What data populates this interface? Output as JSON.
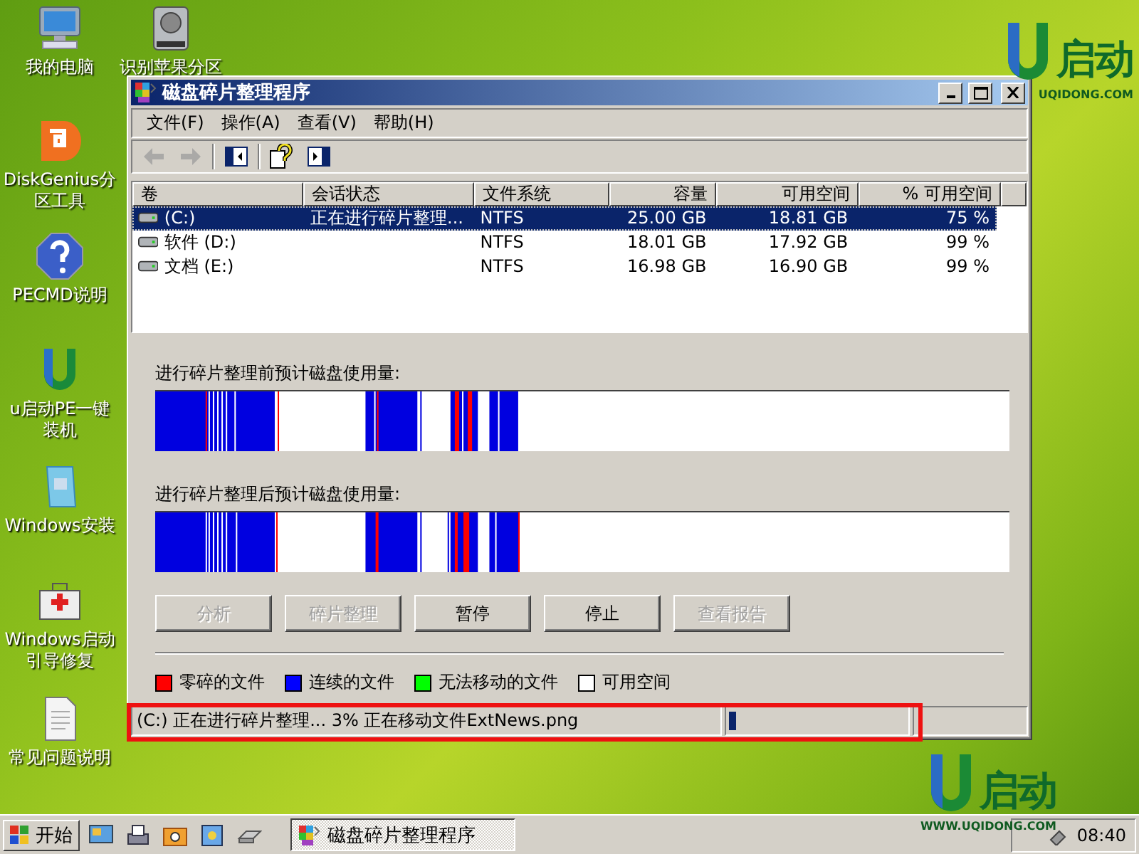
{
  "desktop_icons": [
    {
      "label": "我的电脑",
      "kind": "computer"
    },
    {
      "label": "识别苹果分区",
      "kind": "drive"
    },
    {
      "label": "DiskGenius分区工具",
      "kind": "diskgenius"
    },
    {
      "label": "PECMD说明",
      "kind": "help"
    },
    {
      "label": "u启动PE一键装机",
      "kind": "ulogo"
    },
    {
      "label": "Windows安装",
      "kind": "windows"
    },
    {
      "label": "Windows启动引导修复",
      "kind": "firstaid"
    },
    {
      "label": "常见问题说明",
      "kind": "document"
    }
  ],
  "logo_top": {
    "name": "启动",
    "site": "UQIDONG.COM"
  },
  "logo_bottom": {
    "name": "启动",
    "site": "WWW.UQIDONG.COM"
  },
  "window": {
    "title": "磁盘碎片整理程序",
    "menu": [
      "文件(F)",
      "操作(A)",
      "查看(V)",
      "帮助(H)"
    ],
    "toolbar": [
      {
        "kind": "back",
        "disabled": true
      },
      {
        "kind": "forward",
        "disabled": true
      },
      {
        "kind": "panel-left"
      },
      {
        "kind": "help"
      },
      {
        "kind": "panel-right"
      }
    ],
    "table": {
      "columns": [
        "卷",
        "会话状态",
        "文件系统",
        "容量",
        "可用空间",
        "% 可用空间"
      ],
      "rows": [
        {
          "cells": [
            "(C:)",
            "正在进行碎片整理...",
            "NTFS",
            "25.00 GB",
            "18.81 GB",
            "75 %"
          ],
          "selected": true
        },
        {
          "cells": [
            "软件 (D:)",
            "",
            "NTFS",
            "18.01 GB",
            "17.92 GB",
            "99 %"
          ],
          "selected": false
        },
        {
          "cells": [
            "文档 (E:)",
            "",
            "NTFS",
            "16.98 GB",
            "16.90 GB",
            "99 %"
          ],
          "selected": false
        }
      ]
    },
    "before_label": "进行碎片整理前预计磁盘使用量:",
    "after_label": "进行碎片整理后预计磁盘使用量:",
    "buttons": [
      {
        "label": "分析",
        "disabled": true
      },
      {
        "label": "碎片整理",
        "disabled": true
      },
      {
        "label": "暂停",
        "disabled": false
      },
      {
        "label": "停止",
        "disabled": false
      },
      {
        "label": "查看报告",
        "disabled": true
      }
    ],
    "legend": [
      {
        "label": "零碎的文件",
        "color": "#ff0000"
      },
      {
        "label": "连续的文件",
        "color": "#0000ff"
      },
      {
        "label": "无法移动的文件",
        "color": "#00ff00"
      },
      {
        "label": "可用空间",
        "color": "#ffffff"
      }
    ],
    "status_bar": {
      "text": "(C:) 正在进行碎片整理... 3%  正在移动文件ExtNews.png",
      "level": 0.04
    }
  },
  "taskbar": {
    "start": "开始",
    "tasks": [
      {
        "label": "磁盘碎片整理程序",
        "selected": true
      }
    ],
    "clock": "08:40"
  }
}
